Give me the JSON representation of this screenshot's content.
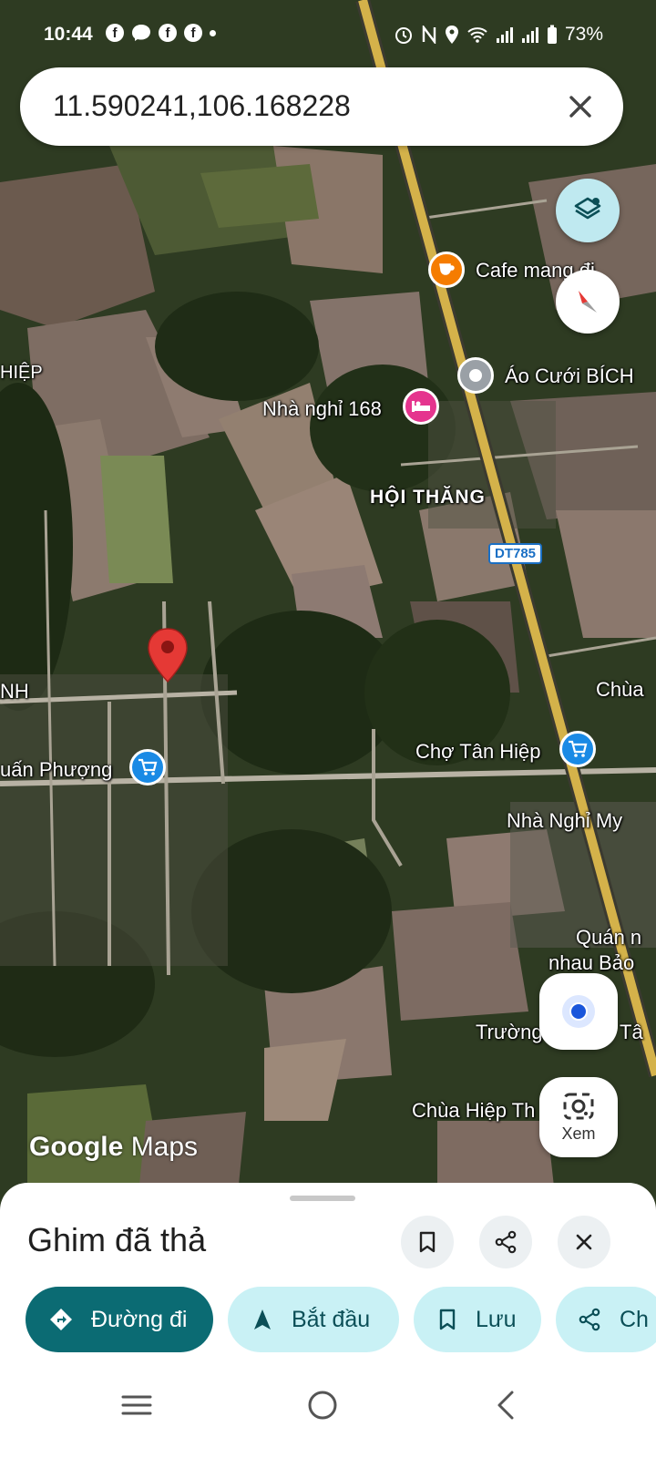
{
  "status_bar": {
    "time": "10:44",
    "battery": "73%",
    "notification_icons": [
      "facebook-icon",
      "messenger-icon",
      "facebook-icon",
      "facebook-icon",
      "dot-icon"
    ],
    "system_icons": [
      "alarm-icon",
      "nfc-icon",
      "location-icon",
      "wifi-icon",
      "signal-icon",
      "signal-icon",
      "battery-icon"
    ]
  },
  "search": {
    "query": "11.590241,106.168228"
  },
  "map": {
    "labels": {
      "hiep": "HIỆP",
      "cafe": "Cafe mang đi",
      "ao_cuoi": "Áo Cưới BÍCH",
      "nha_nghi_168": "Nhà nghỉ 168",
      "hoi_thang": "HỘI THĂNG",
      "road_dt785": "DT785",
      "nh": "NH",
      "chua": "Chùa",
      "cho_tan_hiep": "Chợ Tân Hiệp",
      "tuan_phuong": "uấn Phượng",
      "nha_nghi_my": "Nhà Nghỉ My",
      "quan_nhau_1": "Quán n",
      "quan_nhau_2": "nhau Bảo",
      "truong": "Trường",
      "ta": "Tâ",
      "chua_hiep": "Chùa Hiệp Th"
    },
    "logo_google": "Google",
    "logo_maps": "Maps"
  },
  "buttons": {
    "layers": "layers-icon",
    "compass": "compass-icon",
    "my_location": "my-location-icon",
    "lens_label": "Xem"
  },
  "sheet": {
    "title": "Ghim đã thả",
    "chips": {
      "directions": "Đường đi",
      "start": "Bắt đầu",
      "save": "Lưu",
      "share": "Ch"
    }
  },
  "colors": {
    "primary_chip": "#0b6b73",
    "secondary_chip": "#c9f1f5",
    "pin": "#e53935",
    "hotel_poi": "#e5348e",
    "cafe_poi": "#f57c00",
    "shop_poi": "#1a8ae5"
  }
}
